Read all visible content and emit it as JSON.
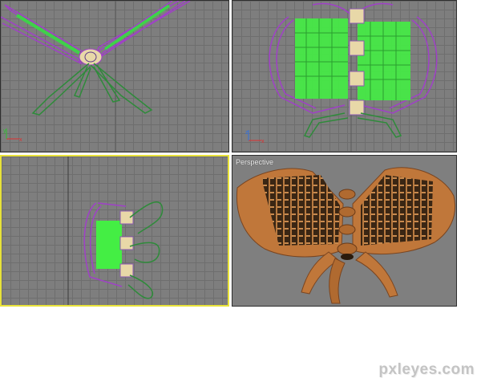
{
  "viewports": {
    "top": {
      "label": ""
    },
    "front": {
      "label": ""
    },
    "left": {
      "label": ""
    },
    "perspective": {
      "label": "Perspective"
    }
  },
  "axis": {
    "x": "x",
    "y": "y",
    "z": "z"
  },
  "colors": {
    "viewport_bg": "#7e7e7e",
    "grid": "#6e6e6e",
    "active_border": "#e8e23a",
    "wire_purple": "#a040c8",
    "wire_green": "#2e8b3a",
    "mesh_green": "#44ff44",
    "wood": "#c0773a"
  },
  "watermark": "pxleyes.com"
}
